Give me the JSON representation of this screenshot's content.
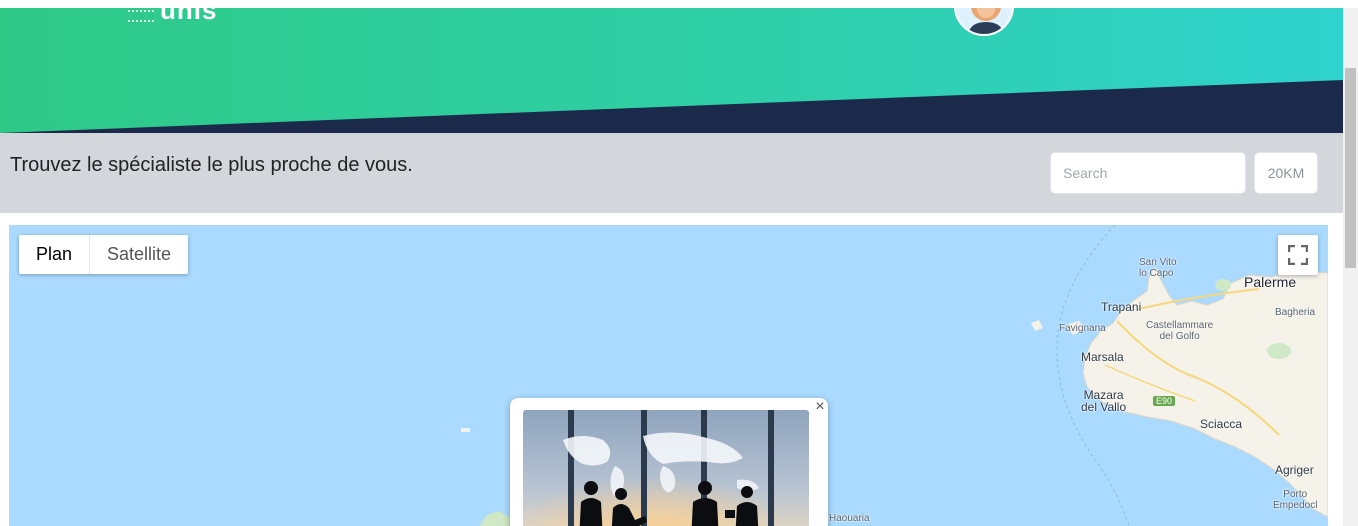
{
  "header": {
    "logo_text": "unis",
    "colors": {
      "gradient_start": "#2ec987",
      "gradient_end": "#2fd2cd",
      "navy": "#1b2a4b"
    }
  },
  "search": {
    "tagline": "Trouvez le spécialiste le plus proche de vous.",
    "placeholder": "Search",
    "radius_label": "20KM"
  },
  "map": {
    "type_buttons": [
      {
        "label": "Plan",
        "active": true
      },
      {
        "label": "Satellite",
        "active": false
      }
    ],
    "fullscreen_icon": "fullscreen-icon",
    "places": {
      "san_vito": "San Vito\nlo Capo",
      "palerme": "Palerme",
      "trapani": "Trapani",
      "bagheria": "Bagheria",
      "favignana": "Favignana",
      "castellammare": "Castellammare\ndel Golfo",
      "marsala": "Marsala",
      "mazara": "Mazara\ndel Vallo",
      "sciacca": "Sciacca",
      "agrigento": "Agriger",
      "porto": "Porto\nEmpedocl",
      "haouaria": "Haouaria"
    },
    "road_label": "E90",
    "colors": {
      "water": "#aadaff",
      "land": "#f5f2ea"
    }
  },
  "info_window": {
    "close_symbol": "×"
  }
}
